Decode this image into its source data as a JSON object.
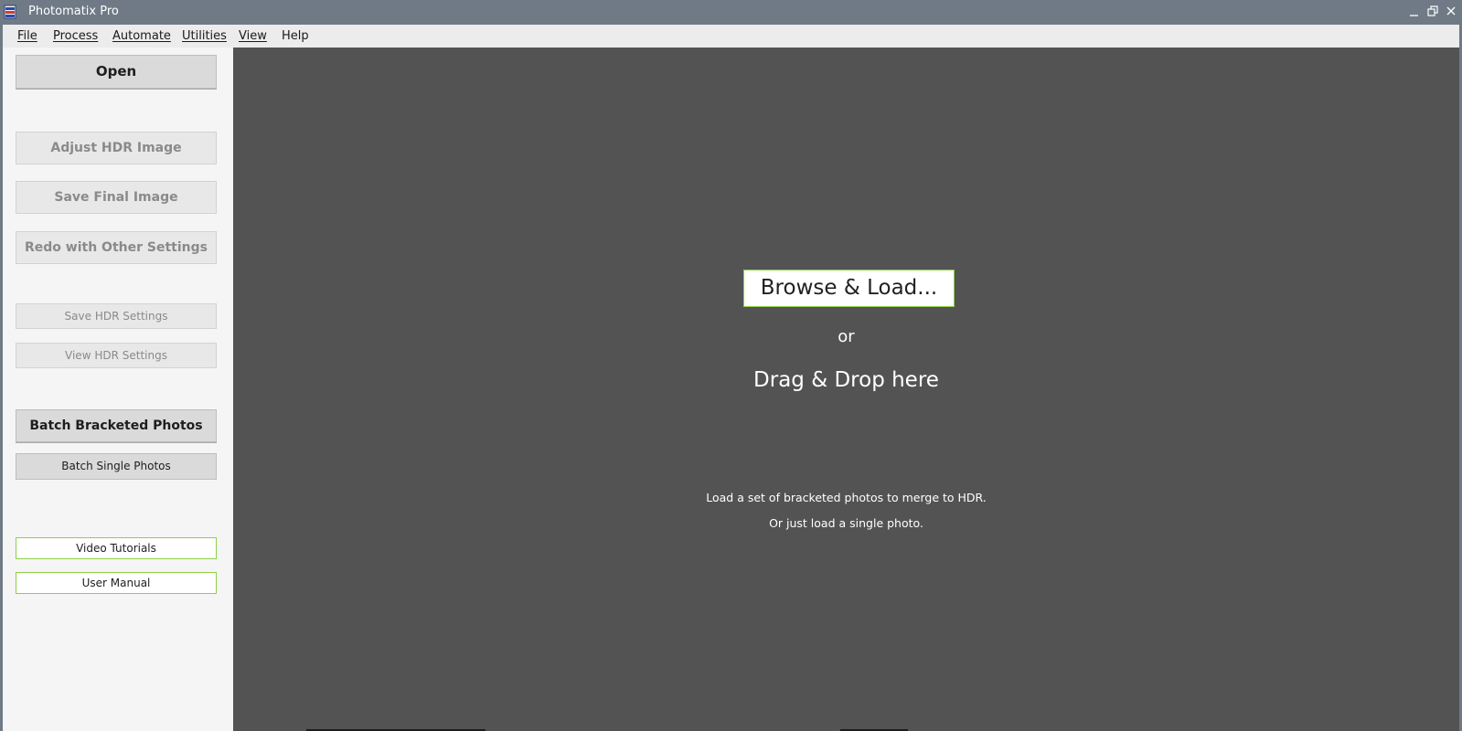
{
  "window": {
    "title": "Photomatix Pro",
    "controls": [
      "minimize-icon",
      "restore-icon",
      "close-icon"
    ]
  },
  "menu": {
    "items": [
      "File",
      "Process",
      "Automate",
      "Utilities",
      "View",
      "Help"
    ]
  },
  "sidebar": {
    "open": "Open",
    "adjust_hdr": "Adjust HDR Image",
    "save_final": "Save Final Image",
    "redo": "Redo with Other Settings",
    "save_hdr_settings": "Save HDR Settings",
    "view_hdr_settings": "View HDR Settings",
    "batch_bracketed": "Batch Bracketed Photos",
    "batch_single": "Batch Single Photos",
    "video_tutorials": "Video Tutorials",
    "user_manual": "User Manual"
  },
  "main": {
    "browse_label": "Browse & Load...",
    "or_label": "or",
    "drag_drop_label": "Drag & Drop here",
    "hint_line1": "Load a set of bracketed photos to merge to HDR.",
    "hint_line2": "Or just load a single photo."
  },
  "colors": {
    "titlebar": "#6f7a86",
    "menubar": "#ececec",
    "sidebar": "#f5f5f5",
    "workspace": "#535353",
    "accent_green": "#8ed04a"
  }
}
